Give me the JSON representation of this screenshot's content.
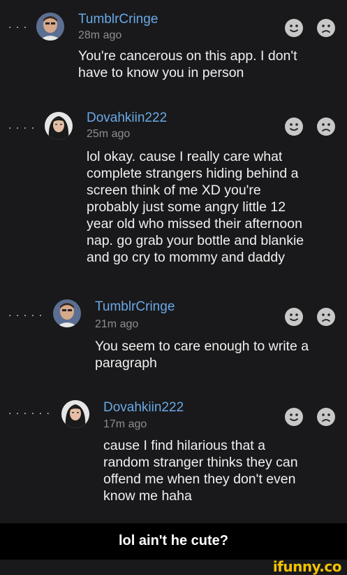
{
  "comments": [
    {
      "username": "TumblrCringe",
      "time": "28m ago",
      "text": "You're cancerous on this app. I don't\nhave to know you in person",
      "thread_dots": "· · ·"
    },
    {
      "username": "Dovahkiin222",
      "time": "25m ago",
      "text": "lol okay. cause I really care what\ncomplete strangers hiding behind a\nscreen think of me XD you're\nprobably just some angry little 12\nyear old who missed their afternoon\nnap. go grab your bottle and blankie\nand go cry to mommy and daddy",
      "thread_dots": "· · · ·"
    },
    {
      "username": "TumblrCringe",
      "time": "21m ago",
      "text": "You seem to care enough to write a\nparagraph",
      "thread_dots": "· · · · ·"
    },
    {
      "username": "Dovahkiin222",
      "time": "17m ago",
      "text": "cause I find hilarious that a\nrandom stranger thinks they can\noffend me when they don't even\nknow me haha",
      "thread_dots": "· · · · · ·"
    }
  ],
  "caption": "lol ain't he cute?",
  "watermark": "ifunny.co",
  "colors": {
    "background": "#19191b",
    "username": "#6aa9e6",
    "timestamp": "#8e8e93",
    "text": "#f0f0f0",
    "reaction_face": "#c8c8c8",
    "watermark": "#f2c200"
  },
  "icons": {
    "like": "smiley-face-icon",
    "dislike": "frowning-face-icon"
  }
}
